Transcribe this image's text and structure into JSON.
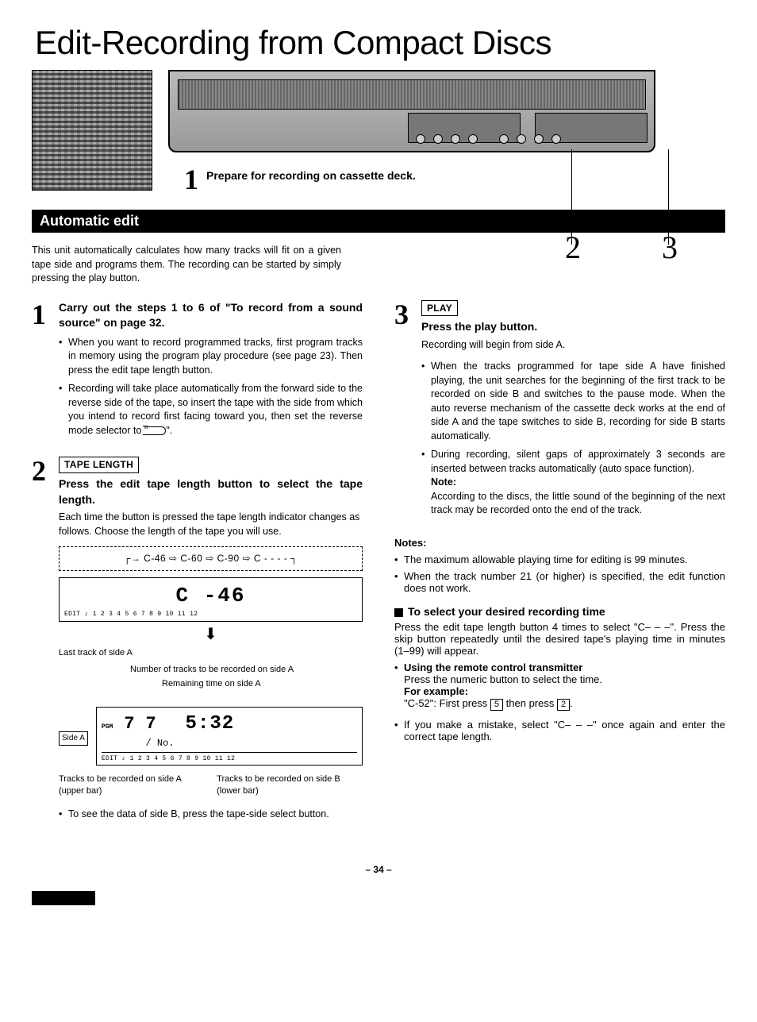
{
  "title": "Edit-Recording from Compact Discs",
  "callout1": {
    "num": "1",
    "text": "Prepare for recording on cassette deck."
  },
  "calloutNums": {
    "two": "2",
    "three": "3"
  },
  "sectionBar": "Automatic edit",
  "intro": "This unit automatically calculates how many tracks will fit on a given tape side and programs them. The recording can be started by simply pressing the play button.",
  "step1": {
    "num": "1",
    "head": "Carry out the steps 1 to 6 of \"To record from a sound source\" on page 32.",
    "b1": "When you want to record programmed tracks, first program tracks in memory using the program play procedure (see page 23). Then press the edit tape length button.",
    "b2a": "Recording will take place automatically from the forward side to the reverse side of the tape, so insert the tape with the side from which you intend to record first facing toward you, then set the reverse mode selector to \"",
    "b2b": "\"."
  },
  "step2": {
    "num": "2",
    "label": "TAPE LENGTH",
    "head": "Press the edit tape length button to select the tape length.",
    "body": "Each time the button is pressed the tape length indicator changes as follows. Choose the length of the tape you will use.",
    "flow": "┌→ C-46 ⇨ C-60 ⇨ C-90 ⇨ C - - - - ┐",
    "disp1_seg": "C -46",
    "disp1_row": "EDIT ♪ 1  2  3  4  5  6  7  8  9  10  11  12",
    "lastTrack": "Last track of side A",
    "anno1": "Number of tracks to be recorded on side A",
    "anno2": "Remaining time on side A",
    "sideA": "Side A",
    "pgm": "PGM",
    "disp2_track": "7",
    "disp2_trackNo": "7",
    "disp2_noLabel": "/ No.",
    "disp2_time": "5:32",
    "disp2_row": "EDIT ♪ 1  2  3  4  5  6  7  8  9  10  11  12",
    "cap1": "Tracks to be recorded on side A (upper bar)",
    "cap2": "Tracks to be recorded on side B (lower bar)",
    "foot": "To see the data of side B, press the tape-side select button."
  },
  "step3": {
    "num": "3",
    "label": "PLAY",
    "head": "Press the play button.",
    "sub": "Recording will begin from side A.",
    "b1": "When the tracks programmed for tape side A have finished playing, the unit searches for the beginning of the first track to be recorded on side B and switches to the pause mode. When the auto reverse mechanism of the cassette deck works at the end of side A and the tape switches to side B, recording for side B starts automatically.",
    "b2": "During recording, silent gaps of approximately 3 seconds are inserted between tracks automatically (auto space function).",
    "noteLabel": "Note:",
    "note": "According to the discs, the little sound of the beginning of the next track may be recorded onto the end of the track."
  },
  "notesBlock": {
    "head": "Notes:",
    "b1": "The maximum allowable playing time for editing is 99 minutes.",
    "b2": "When the track number 21 (or higher) is specified, the edit function does not work."
  },
  "selectTime": {
    "head": "To select your desired recording time",
    "body": "Press the edit tape length button 4 times to select \"C– – –\". Press the skip button repeatedly until the desired tape's playing time in minutes (1–99) will appear.",
    "remoteHead": "Using the remote control transmitter",
    "remoteBody": "Press the numeric button to select the time.",
    "exampleLabel": "For example:",
    "example_a": "\"C-52\": First press ",
    "key5": "5",
    "example_b": " then press ",
    "key2": "2",
    "example_c": ".",
    "mistake": "If you make a mistake, select \"C– – –\" once again and enter the correct tape length."
  },
  "pageNum": "– 34 –"
}
